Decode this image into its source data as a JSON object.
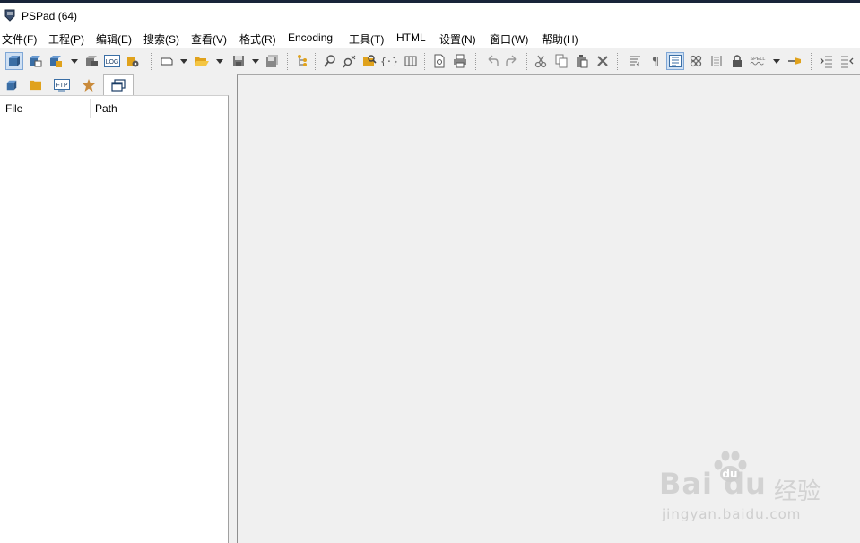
{
  "window": {
    "title": "PSPad (64)"
  },
  "menu": {
    "items": [
      "文件(F)",
      "工程(P)",
      "编辑(E)",
      "搜索(S)",
      "查看(V)",
      "格式(R)",
      "Encoding",
      "工具(T)",
      "HTML",
      "设置(N)",
      "窗口(W)",
      "帮助(H)"
    ]
  },
  "toolbar": {
    "log_label": "LOG",
    "spell_label": "SPELL"
  },
  "panel": {
    "tabs": [
      "project-tab",
      "folder-tab",
      "ftp-tab",
      "favorites-tab",
      "open-files-tab"
    ],
    "ftp_label": "FTP",
    "columns": {
      "file": "File",
      "path": "Path"
    }
  },
  "watermark": {
    "brand": "Bai du",
    "cn": "经验",
    "url": "jingyan.baidu.com"
  },
  "colors": {
    "accent": "#cfe0f3",
    "folder": "#e0a21c",
    "star": "#c98a3b",
    "icon_blue": "#3a6ea5"
  }
}
